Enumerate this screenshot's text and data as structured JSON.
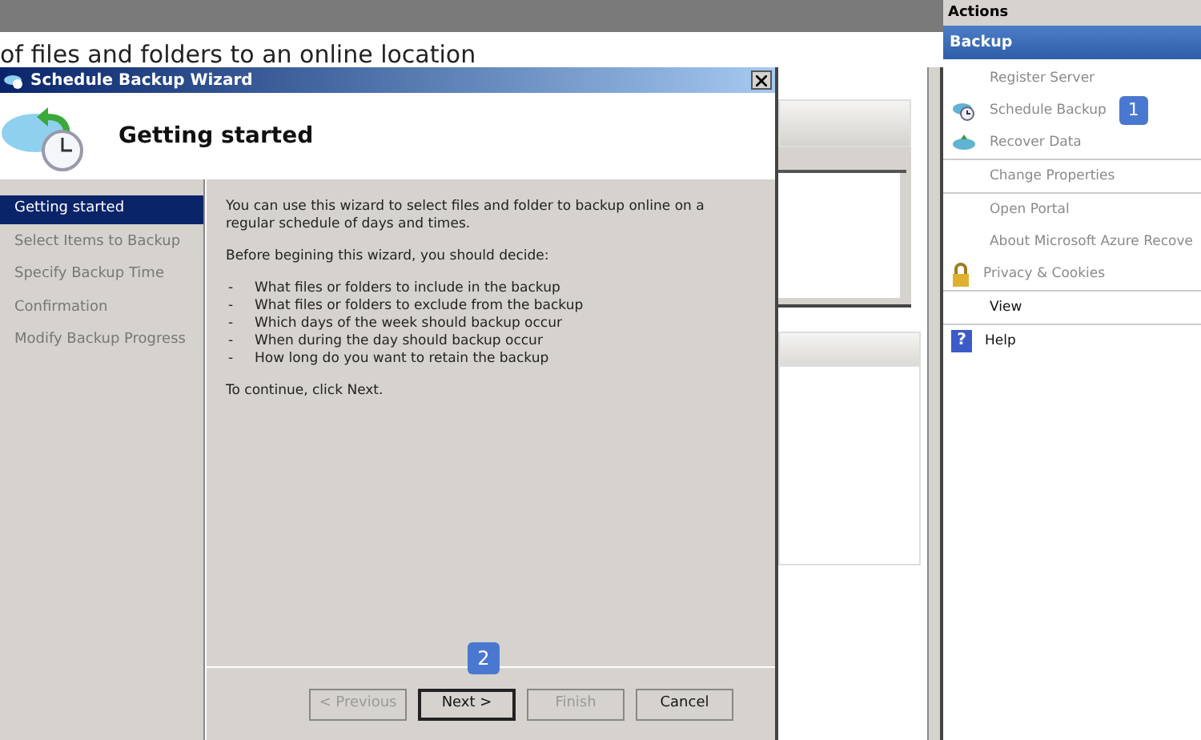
{
  "background": {
    "heading": "of files and folders to an online location"
  },
  "wizard": {
    "title": "Schedule Backup Wizard",
    "page_title": "Getting started",
    "steps": [
      {
        "label": "Getting started",
        "selected": true
      },
      {
        "label": "Select Items to Backup",
        "selected": false
      },
      {
        "label": "Specify Backup Time",
        "selected": false
      },
      {
        "label": "Confirmation",
        "selected": false
      },
      {
        "label": "Modify Backup Progress",
        "selected": false
      }
    ],
    "intro": "You can use this wizard to select files and folder to backup online on a regular schedule of days and times.",
    "lead": "Before begining this wizard, you should decide:",
    "bullets": [
      {
        "marker": "-",
        "text": "What files or folders to include in the backup"
      },
      {
        "marker": "-",
        "text": "What files or folders to exclude from the backup"
      },
      {
        "marker": "-",
        "text": "Which days of the week should backup occur"
      },
      {
        "marker": "-",
        "text": "When during the day should backup occur"
      },
      {
        "marker": "-",
        "text": "How long do you want to retain the backup"
      }
    ],
    "closing": "To continue, click Next.",
    "callout": "2",
    "buttons": [
      {
        "label": "< Previous",
        "disabled": true,
        "default": false
      },
      {
        "label": "Next >",
        "disabled": false,
        "default": true
      },
      {
        "label": "Finish",
        "disabled": true,
        "default": false
      },
      {
        "label": "Cancel",
        "disabled": false,
        "default": false
      }
    ]
  },
  "actions": {
    "title": "Actions",
    "section": "Backup",
    "items": [
      {
        "label": "Register Server",
        "kind": "plain",
        "disabled": true
      },
      {
        "label": "Schedule Backup",
        "kind": "schedule",
        "disabled": true,
        "callout": "1"
      },
      {
        "label": "Recover Data",
        "kind": "cloud",
        "disabled": true
      },
      {
        "kind": "separator"
      },
      {
        "label": "Change Properties",
        "kind": "plain",
        "disabled": true
      },
      {
        "kind": "separator"
      },
      {
        "label": "Open Portal",
        "kind": "plain",
        "disabled": true
      },
      {
        "label": "About Microsoft Azure Recove",
        "kind": "plain",
        "disabled": true
      },
      {
        "label": "Privacy & Cookies",
        "kind": "lock",
        "disabled": true
      },
      {
        "kind": "separator"
      },
      {
        "label": "View",
        "kind": "plain",
        "disabled": false
      },
      {
        "kind": "separator"
      },
      {
        "label": "Help",
        "kind": "help",
        "glyph": "?",
        "disabled": false
      }
    ]
  }
}
